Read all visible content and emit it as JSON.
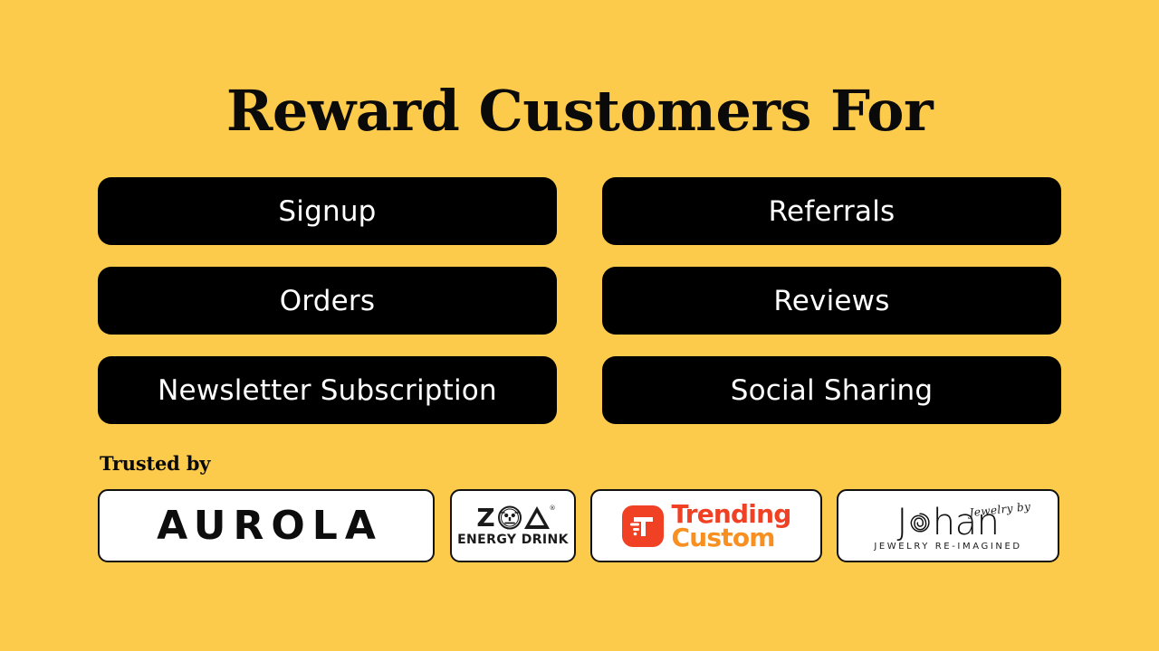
{
  "theme": {
    "background_color": "#FDCB4C",
    "pill_color": "#000000",
    "pill_text_color": "#FFFFFF",
    "card_color": "#FFFFFF",
    "card_border_color": "#111111",
    "heading_color": "#0A0A0A"
  },
  "heading": {
    "title": "Reward Customers For"
  },
  "rewards": {
    "left_column": [
      {
        "label": "Signup"
      },
      {
        "label": "Orders"
      },
      {
        "label": "Newsletter Subscription"
      }
    ],
    "right_column": [
      {
        "label": "Referrals"
      },
      {
        "label": "Reviews"
      },
      {
        "label": "Social Sharing"
      }
    ]
  },
  "trusted": {
    "label": "Trusted by",
    "logos": [
      {
        "name": "aurola",
        "wordmark": "AUROLA"
      },
      {
        "name": "zoa",
        "letter_z": "Z",
        "tagline": "ENERGY DRINK",
        "trademark": "®"
      },
      {
        "name": "trending-custom",
        "line1": "Trending",
        "line2": "Custom",
        "line1_color": "#F04124",
        "line2_color": "#F79021",
        "icon_color": "#F04124"
      },
      {
        "name": "johan",
        "script": "Jewelry by",
        "word_start": "J",
        "word_end": "han",
        "tagline": "JEWELRY RE-IMAGINED"
      }
    ]
  }
}
